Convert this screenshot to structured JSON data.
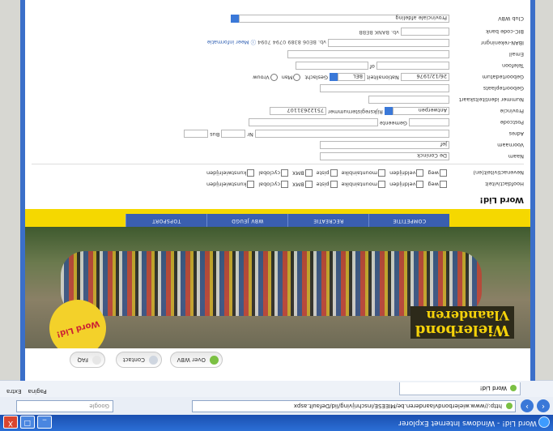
{
  "window": {
    "title": "Word Lid! - Windows Internet Explorer",
    "buttons": [
      "_",
      "□",
      "X"
    ]
  },
  "browser": {
    "url": "http://www.wielerbondvlaanderen.be/MIEESE/inschrijving/lid/Default.aspx",
    "search_placeholder": "Google",
    "tab_label": "Word Lid!",
    "toolbar_items": [
      "Pagina",
      "Extra"
    ]
  },
  "site": {
    "nav_buttons": [
      "Over WBV",
      "Contact",
      "FAQ"
    ],
    "logo_line1": "Wielerbond",
    "logo_line2": "Vlaanderen",
    "badge": "Word Lid!",
    "menu": [
      "COMPETITIE",
      "RECREATIE",
      "WBV JEUGD",
      "TOPSPORT"
    ]
  },
  "form": {
    "title": "Word Lid!",
    "fields": {
      "hoofdactiviteit_label": "Hoofdactiviteit",
      "nevenactiviteiten_label": "Nevenactiviteit(en)",
      "activities": [
        "weg",
        "veldrijden",
        "mountainbike",
        "piste",
        "BMX",
        "cyclobal",
        "kunstwielrijden"
      ],
      "naam_label": "Naam",
      "naam_value": "De Coninck",
      "voornaam_label": "Voornaam",
      "voornaam_value": "Jef",
      "adres_label": "Adres",
      "nr_label": "Nr",
      "bus_label": "Bus",
      "postcode_label": "Postcode",
      "gemeente_label": "Gemeente",
      "provincie_label": "Provincie",
      "provincie_value": "Antwerpen",
      "rijksregister_label": "Rijksregisternummer",
      "rijksregister_value": "75122631107",
      "nummer_id_label": "Nummer identiteitskaart",
      "geboorteplaats_label": "Geboorteplaats",
      "geboortedatum_label": "Geboortedatum",
      "geboortedatum_value": "26/12/1976",
      "nationaliteit_label": "Nationaliteit",
      "nationaliteit_value": "BEL",
      "geslacht_label": "Geslacht",
      "geslacht_options": [
        "Man",
        "Vrouw"
      ],
      "telefoon_label": "Telefoon",
      "gsm_label": "of",
      "email_label": "Email",
      "iban_label": "IBAN-rekeningnr",
      "iban_example": "vb. BE06 8389 0794 7094",
      "meer_info": "Meer informatie",
      "bic_label": "BIC-code bank",
      "bic_example": "vb. BANK BEBB",
      "club_label": "Club WBV",
      "club_value": "Provinciale afdeling"
    }
  }
}
